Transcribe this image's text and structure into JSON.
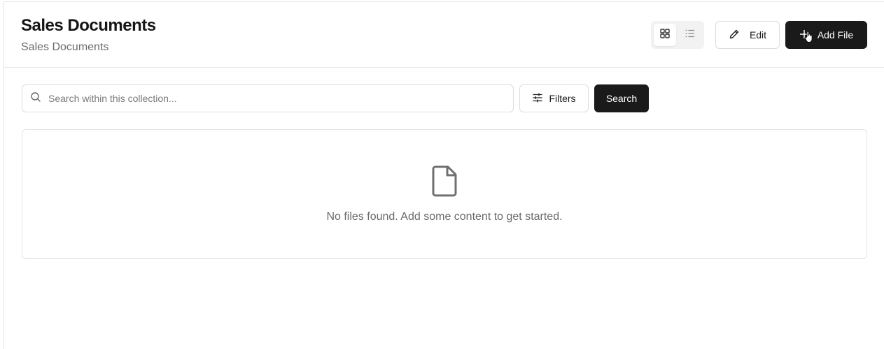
{
  "header": {
    "title": "Sales Documents",
    "subtitle": "Sales Documents",
    "view_toggle": {
      "options": [
        "grid-icon",
        "list-icon"
      ],
      "selected": "grid"
    },
    "edit_label": "Edit",
    "add_file_label": "Add File"
  },
  "toolbar": {
    "search_placeholder": "Search within this collection...",
    "search_value": "",
    "filters_label": "Filters",
    "search_label": "Search"
  },
  "empty_state": {
    "icon": "file-icon",
    "message": "No files found. Add some content to get started."
  },
  "colors": {
    "primary_button": "#1a1a1a",
    "border": "#dcdcdc",
    "muted_text": "#6b6b6b"
  }
}
